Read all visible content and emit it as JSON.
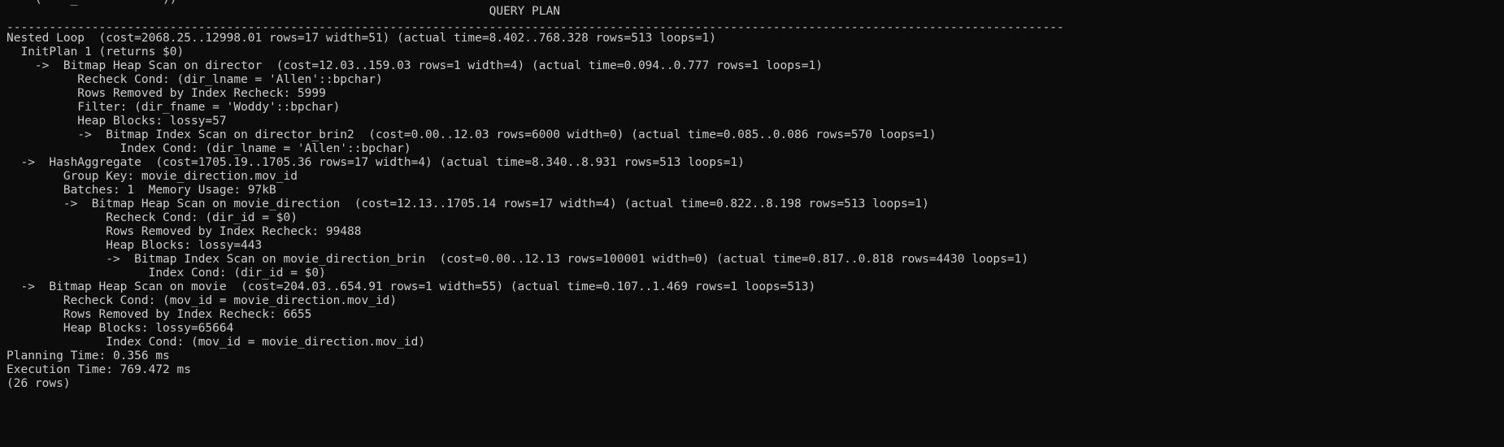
{
  "terminal": {
    "partial_top_line": "    (    _            ))",
    "header": "                                                                    QUERY PLAN",
    "divider": "-----------------------------------------------------------------------------------------------------------------------------------------------------",
    "plan_lines": [
      "Nested Loop  (cost=2068.25..12998.01 rows=17 width=51) (actual time=8.402..768.328 rows=513 loops=1)",
      "  InitPlan 1 (returns $0)",
      "    ->  Bitmap Heap Scan on director  (cost=12.03..159.03 rows=1 width=4) (actual time=0.094..0.777 rows=1 loops=1)",
      "          Recheck Cond: (dir_lname = 'Allen'::bpchar)",
      "          Rows Removed by Index Recheck: 5999",
      "          Filter: (dir_fname = 'Woddy'::bpchar)",
      "          Heap Blocks: lossy=57",
      "          ->  Bitmap Index Scan on director_brin2  (cost=0.00..12.03 rows=6000 width=0) (actual time=0.085..0.086 rows=570 loops=1)",
      "                Index Cond: (dir_lname = 'Allen'::bpchar)",
      "  ->  HashAggregate  (cost=1705.19..1705.36 rows=17 width=4) (actual time=8.340..8.931 rows=513 loops=1)",
      "        Group Key: movie_direction.mov_id",
      "        Batches: 1  Memory Usage: 97kB",
      "        ->  Bitmap Heap Scan on movie_direction  (cost=12.13..1705.14 rows=17 width=4) (actual time=0.822..8.198 rows=513 loops=1)",
      "              Recheck Cond: (dir_id = $0)",
      "              Rows Removed by Index Recheck: 99488",
      "              Heap Blocks: lossy=443",
      "              ->  Bitmap Index Scan on movie_direction_brin  (cost=0.00..12.13 rows=100001 width=0) (actual time=0.817..0.818 rows=4430 loops=1)",
      "                    Index Cond: (dir_id = $0)",
      "  ->  Bitmap Heap Scan on movie  (cost=204.03..654.91 rows=1 width=55) (actual time=0.107..1.469 rows=1 loops=513)",
      "        Recheck Cond: (mov_id = movie_direction.mov_id)",
      "        Rows Removed by Index Recheck: 6655",
      "        Heap Blocks: lossy=65664",
      "              Index Cond: (mov_id = movie_direction.mov_id)",
      "Planning Time: 0.356 ms",
      "Execution Time: 769.472 ms"
    ],
    "partial_bottom_line": "(26 rows)"
  }
}
